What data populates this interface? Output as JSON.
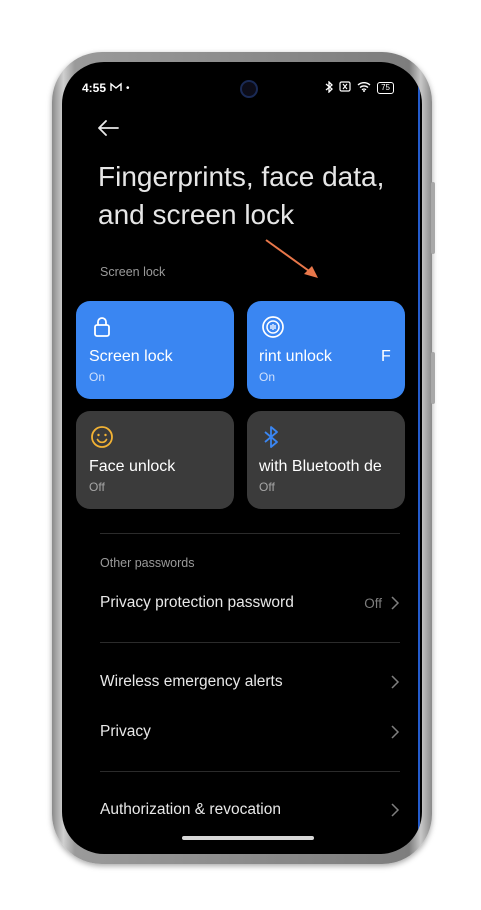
{
  "status_bar": {
    "time": "4:55",
    "left_icons": [
      "gmail-icon",
      "dot-icon"
    ],
    "right_icons": [
      "bluetooth-icon",
      "no-sim-icon",
      "wifi-icon"
    ],
    "battery": "75"
  },
  "page_title": "Fingerprints, face data, and screen lock",
  "screen_lock_section": {
    "label": "Screen lock",
    "tiles": [
      {
        "label": "Screen lock",
        "status": "On",
        "icon": "padlock-icon",
        "state": "on"
      },
      {
        "label": "rint unlock",
        "trailing": "F",
        "status": "On",
        "icon": "fingerprint-icon",
        "state": "on"
      },
      {
        "label": "Face unlock",
        "status": "Off",
        "icon": "smiley-face-icon",
        "state": "off"
      },
      {
        "label": "with Bluetooth de",
        "status": "Off",
        "icon": "bluetooth-icon",
        "state": "off"
      }
    ]
  },
  "other_passwords_section": {
    "label": "Other passwords",
    "items": [
      {
        "label": "Privacy protection password",
        "value": "Off"
      }
    ]
  },
  "more_items": [
    {
      "label": "Wireless emergency alerts"
    },
    {
      "label": "Privacy"
    },
    {
      "label": "Authorization & revocation"
    }
  ],
  "colors": {
    "accent_blue": "#3a86f2",
    "tile_off": "#3b3b3b",
    "annotation_arrow": "#e8774a",
    "face_icon": "#f2b234",
    "bluetooth_icon": "#3a86f2"
  }
}
